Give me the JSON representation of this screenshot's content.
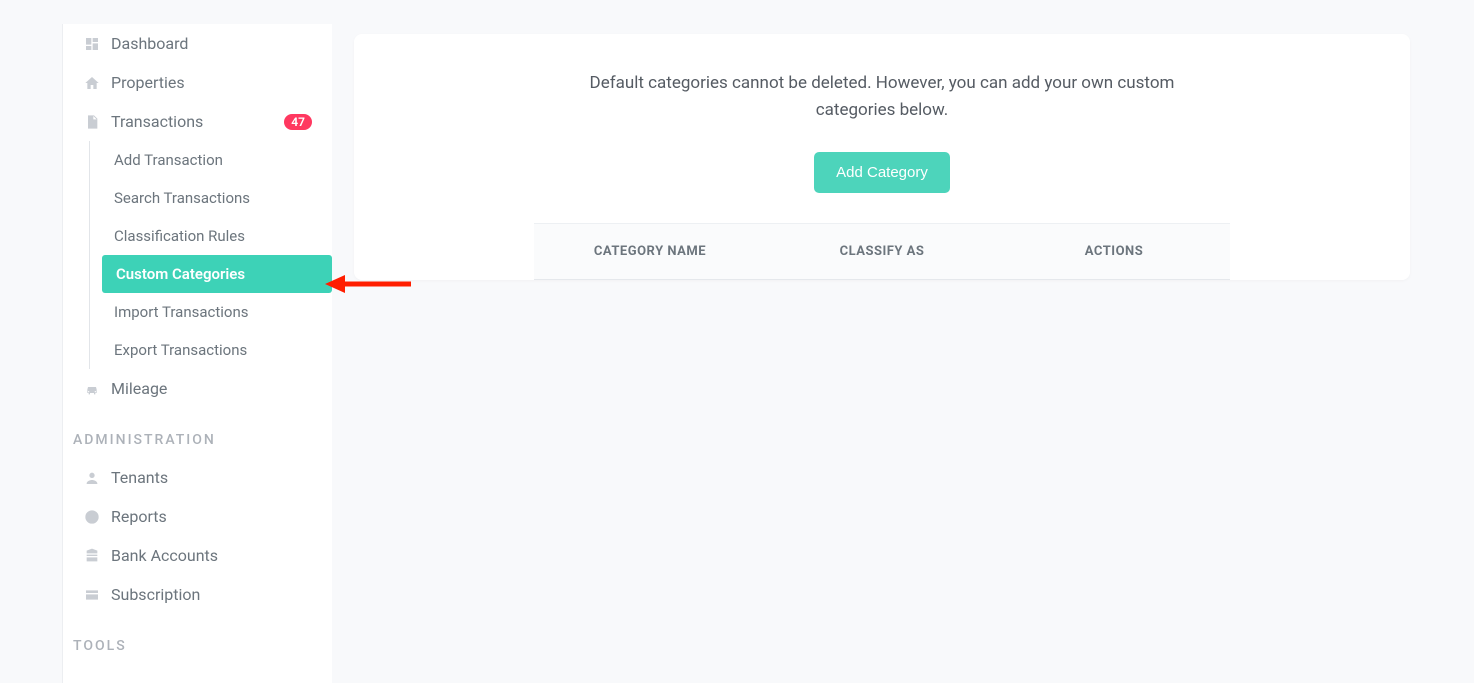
{
  "sidebar": {
    "items": [
      {
        "label": "Dashboard"
      },
      {
        "label": "Properties"
      },
      {
        "label": "Transactions",
        "badge": "47"
      },
      {
        "label": "Mileage"
      }
    ],
    "subitems": [
      {
        "label": "Add Transaction"
      },
      {
        "label": "Search Transactions"
      },
      {
        "label": "Classification Rules"
      },
      {
        "label": "Custom Categories"
      },
      {
        "label": "Import Transactions"
      },
      {
        "label": "Export Transactions"
      }
    ],
    "sections": {
      "administration": "ADMINISTRATION",
      "tools": "TOOLS"
    },
    "admin_items": [
      {
        "label": "Tenants"
      },
      {
        "label": "Reports"
      },
      {
        "label": "Bank Accounts"
      },
      {
        "label": "Subscription"
      }
    ]
  },
  "main": {
    "info_text": "Default categories cannot be deleted. However, you can add your own custom categories below.",
    "add_button": "Add Category",
    "columns": {
      "name": "CATEGORY NAME",
      "classify": "CLASSIFY AS",
      "actions": "ACTIONS"
    }
  }
}
